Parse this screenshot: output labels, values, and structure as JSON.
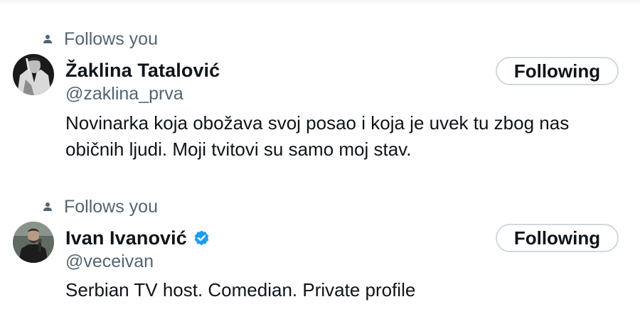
{
  "users": [
    {
      "follows_label": "Follows you",
      "name": "Žaklina Tatalović",
      "handle": "@zaklina_prva",
      "verified": false,
      "button_label": "Following",
      "bio": "Novinarka koja obožava svoj posao i koja je uvek tu zbog nas običnih ljudi. Moji tvitovi su samo moj stav."
    },
    {
      "follows_label": "Follows you",
      "name": "Ivan Ivanović",
      "handle": "@veceivan",
      "verified": true,
      "button_label": "Following",
      "bio": "Serbian TV host. Comedian. Private profile"
    }
  ],
  "colors": {
    "primary_text": "#0f1419",
    "secondary_text": "#536471",
    "button_border": "#cfd9de",
    "verified_blue": "#1d9bf0"
  },
  "icons": {
    "follows": "person-icon",
    "verified": "verified-badge-icon"
  }
}
